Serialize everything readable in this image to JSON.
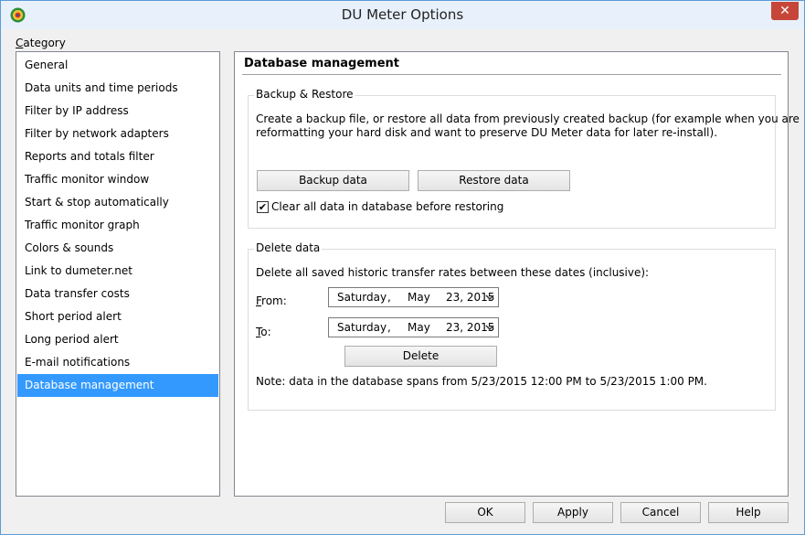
{
  "window": {
    "title": "DU Meter Options",
    "close_glyph": "✕"
  },
  "category": {
    "label_prefix": "C",
    "label_rest": "ategory",
    "items": [
      "General",
      "Data units and time periods",
      "Filter by IP address",
      "Filter by network adapters",
      "Reports and totals filter",
      "Traffic monitor window",
      "Start & stop automatically",
      "Traffic monitor graph",
      "Colors & sounds",
      "Link to dumeter.net",
      "Data transfer costs",
      "Short period alert",
      "Long period alert",
      "E-mail notifications",
      "Database management"
    ],
    "selected_index": 14
  },
  "panel": {
    "title": "Database management",
    "backup": {
      "group_title": "Backup & Restore",
      "description_line1": "Create a backup file, or restore all data from previously created backup (for example when you are",
      "description_line2": "reformatting your hard disk and want to preserve DU Meter data for later re-install).",
      "backup_button": "Backup data",
      "restore_button": "Restore data",
      "clear_checkbox_label": "Clear all data in database before restoring",
      "clear_checked": true
    },
    "delete": {
      "group_title": "Delete data",
      "description": "Delete all saved historic transfer rates between these dates (inclusive):",
      "from_prefix": "F",
      "from_rest": "rom:",
      "to_prefix": "T",
      "to_rest": "o:",
      "from_date": {
        "weekday": "Saturday",
        "sep": ",",
        "month": "May",
        "daynum": "23, 2015"
      },
      "to_date": {
        "weekday": "Saturday",
        "sep": ",",
        "month": "May",
        "daynum": "23, 2015"
      },
      "delete_button": "Delete",
      "note": "Note: data in the database spans from 5/23/2015 12:00 PM to 5/23/2015 1:00 PM."
    }
  },
  "buttons": {
    "ok": "OK",
    "apply": "Apply",
    "cancel": "Cancel",
    "help": "Help"
  },
  "colors": {
    "selection": "#3399ff",
    "title_bar": "#e8f1fb",
    "close_button": "#c7463a"
  }
}
